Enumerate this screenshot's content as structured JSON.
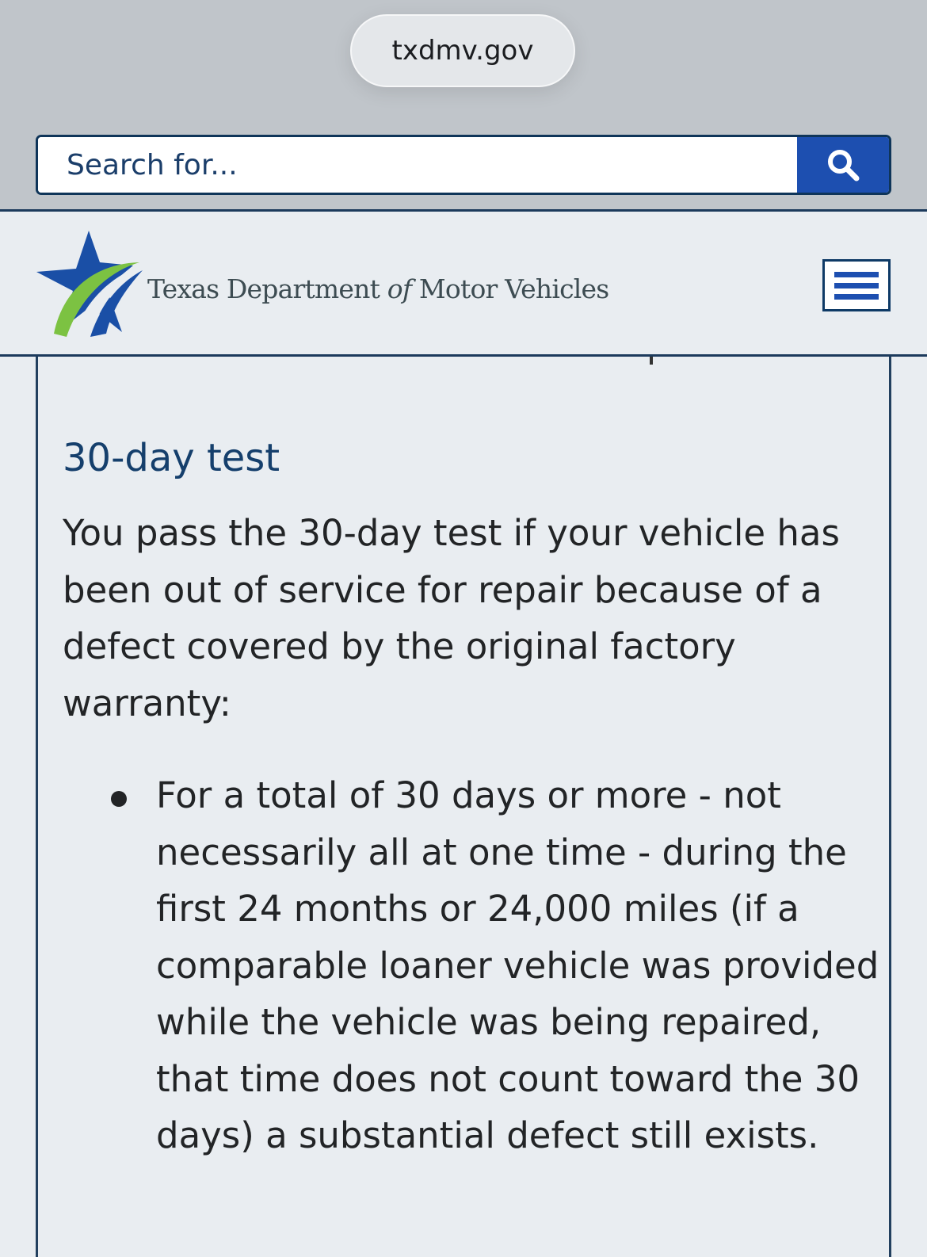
{
  "browser": {
    "url": "txdmv.gov"
  },
  "search": {
    "placeholder": "Search for..."
  },
  "header": {
    "logo_text_part1": "Texas Department ",
    "logo_text_of": "of",
    "logo_text_part2": " Motor Vehicles"
  },
  "content": {
    "heading": "30-day test",
    "paragraph": "You pass the 30-day test if your vehicle has been out of service for repair because of a defect covered by the original factory warranty:",
    "bullets": [
      {
        "text": "For a total of 30 days or more - not necessarily all at one time - during the first 24 months or 24,000 miles (if a comparable loaner vehicle was provided while the vehicle was being repaired, that time does not count toward the 30 days) a substantial defect still exists."
      }
    ]
  },
  "colors": {
    "browser_bg": "#c0c5ca",
    "page_bg": "#e9edf1",
    "brand_blue": "#1d4fb0",
    "heading_blue": "#153f6c",
    "border_navy": "#1c3a5c",
    "logo_green": "#79bd43"
  },
  "icons": {
    "search_button": "search-icon",
    "menu_button": "hamburger-menu-icon",
    "logo": "txdmv-star-logo"
  }
}
